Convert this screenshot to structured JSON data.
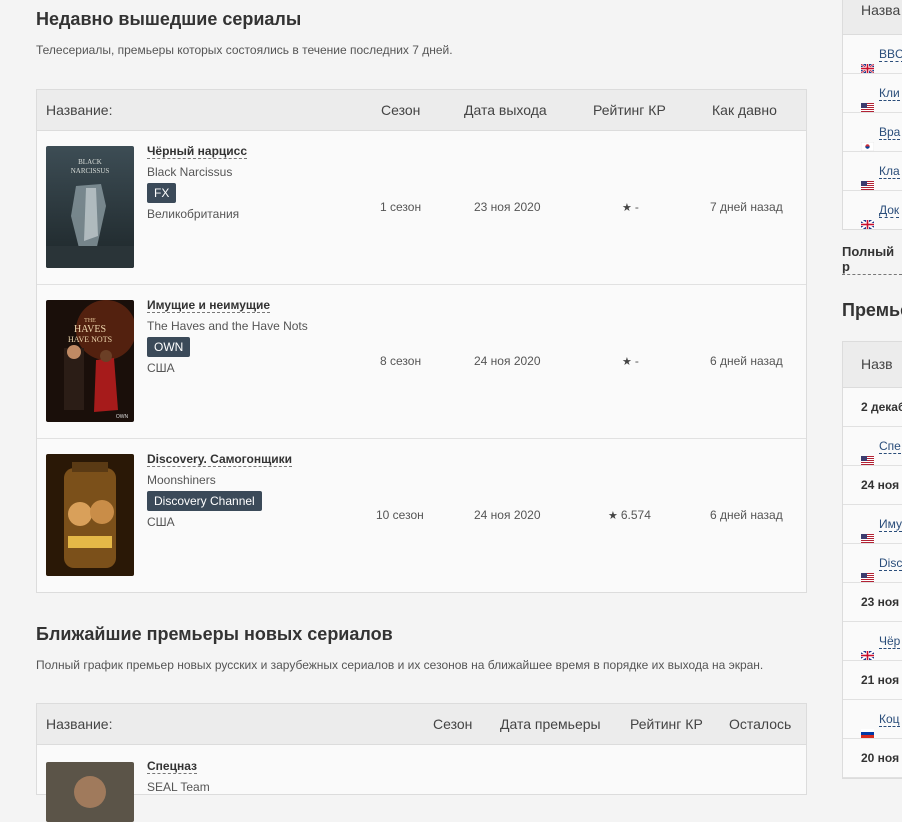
{
  "recent": {
    "title": "Недавно вышедшие сериалы",
    "description": "Телесериалы, премьеры которых состоялись в течение последних 7 дней.",
    "headers": {
      "name": "Название:",
      "season": "Сезон",
      "date": "Дата выхода",
      "rating": "Рейтинг КР",
      "ago": "Как давно"
    },
    "rows": [
      {
        "title": "Чёрный нарцисс",
        "original": "Black Narcissus",
        "network": "FX",
        "country": "Великобритания",
        "season": "1 сезон",
        "date": "23 ноя 2020",
        "rating": "-",
        "ago": "7 дней назад"
      },
      {
        "title": "Имущие и неимущие",
        "original": "The Haves and the Have Nots",
        "network": "OWN",
        "country": "США",
        "season": "8 сезон",
        "date": "24 ноя 2020",
        "rating": "-",
        "ago": "6 дней назад"
      },
      {
        "title": "Discovery. Самогонщики",
        "original": "Moonshiners",
        "network": "Discovery Channel",
        "country": "США",
        "season": "10 сезон",
        "date": "24 ноя 2020",
        "rating": "6.574",
        "ago": "6 дней назад"
      }
    ]
  },
  "upcoming": {
    "title": "Ближайшие премьеры новых сериалов",
    "description": "Полный график премьер новых русских и зарубежных сериалов и их сезонов на ближайшее время в порядке их выхода на экран.",
    "headers": {
      "name": "Название:",
      "season": "Сезон",
      "date": "Дата премьеры",
      "rating": "Рейтинг КР",
      "left": "Осталось"
    },
    "rows": [
      {
        "title": "Спецназ",
        "original": "SEAL Team"
      }
    ]
  },
  "sidebar": {
    "box1_header": "Назва",
    "box1_items": [
      {
        "flag": "uk",
        "text": "BBC"
      },
      {
        "flag": "us",
        "text": "Кли"
      },
      {
        "flag": "kr",
        "text": "Вра"
      },
      {
        "flag": "us",
        "text": "Кла"
      },
      {
        "flag": "uk",
        "text": "Док"
      }
    ],
    "full_link": "Полный р",
    "title2": "Премье",
    "box2_header": "Назв",
    "box2_rows": [
      {
        "type": "date",
        "text": "2 декаб"
      },
      {
        "type": "item",
        "flag": "us",
        "text": "Спе"
      },
      {
        "type": "date",
        "text": "24 ноя"
      },
      {
        "type": "item",
        "flag": "us",
        "text": "Иму"
      },
      {
        "type": "item",
        "flag": "us",
        "text": "Disc"
      },
      {
        "type": "date",
        "text": "23 ноя"
      },
      {
        "type": "item",
        "flag": "uk",
        "text": "Чёр"
      },
      {
        "type": "date",
        "text": "21 ноя"
      },
      {
        "type": "item",
        "flag": "ru",
        "text": "Коц"
      },
      {
        "type": "date",
        "text": "20 ноя"
      }
    ]
  },
  "colors": {
    "badge": "#3b4a59",
    "link": "#2a4d7a"
  }
}
